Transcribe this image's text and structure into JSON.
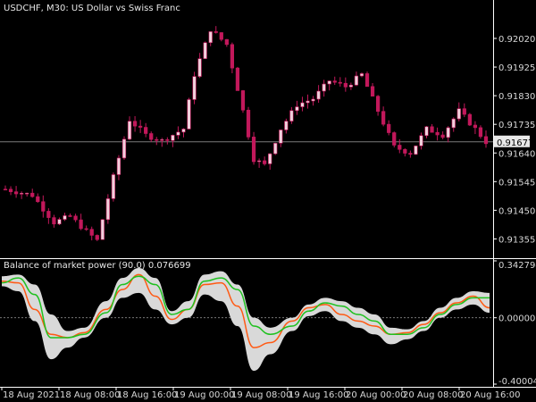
{
  "header": {
    "title": "USDCHF, M30:  US Dollar vs Swiss Franc"
  },
  "indicator": {
    "title": "Balance of market power (90.0) 0.076699"
  },
  "colors": {
    "background": "#000000",
    "candle": "#c2185b",
    "candle_light": "#f0d0dc",
    "axis": "#ffffff",
    "current_price_line": "#7a7a7a",
    "band_fill": "#d9d9d9",
    "green_line": "#1fc11f",
    "orange_line": "#ff5a14",
    "zero_line": "#777777"
  },
  "price_axis": {
    "labels": [
      "0.92020",
      "0.91925",
      "0.91830",
      "0.91735",
      "0.91640",
      "0.91545",
      "0.91450",
      "0.91355"
    ],
    "current_price": "0.91677"
  },
  "indicator_axis": {
    "labels": [
      "0.342794",
      "0.000000",
      "-0.400045"
    ]
  },
  "time_axis": {
    "labels": [
      "18 Aug 2021",
      "18 Aug 08:00",
      "18 Aug 16:00",
      "19 Aug 00:00",
      "19 Aug 08:00",
      "19 Aug 16:00",
      "20 Aug 00:00",
      "20 Aug 08:00",
      "20 Aug 16:00"
    ]
  },
  "chart_data": [
    {
      "type": "candlestick",
      "title": "USDCHF, M30:  US Dollar vs Swiss Franc",
      "ylim": [
        0.913,
        0.921
      ],
      "current_price": 0.91677,
      "bar_count": 90,
      "close_path": [
        {
          "bar": 0,
          "price": 0.9152
        },
        {
          "bar": 5,
          "price": 0.915
        },
        {
          "bar": 9,
          "price": 0.9141
        },
        {
          "bar": 12,
          "price": 0.9143
        },
        {
          "bar": 15,
          "price": 0.9138
        },
        {
          "bar": 17,
          "price": 0.9135
        },
        {
          "bar": 20,
          "price": 0.9156
        },
        {
          "bar": 23,
          "price": 0.9175
        },
        {
          "bar": 26,
          "price": 0.917
        },
        {
          "bar": 29,
          "price": 0.9168
        },
        {
          "bar": 33,
          "price": 0.9172
        },
        {
          "bar": 35,
          "price": 0.919
        },
        {
          "bar": 38,
          "price": 0.9205
        },
        {
          "bar": 41,
          "price": 0.92
        },
        {
          "bar": 44,
          "price": 0.9178
        },
        {
          "bar": 46,
          "price": 0.9162
        },
        {
          "bar": 48,
          "price": 0.916
        },
        {
          "bar": 51,
          "price": 0.9172
        },
        {
          "bar": 54,
          "price": 0.918
        },
        {
          "bar": 57,
          "price": 0.9182
        },
        {
          "bar": 60,
          "price": 0.9188
        },
        {
          "bar": 63,
          "price": 0.9186
        },
        {
          "bar": 66,
          "price": 0.919
        },
        {
          "bar": 69,
          "price": 0.9178
        },
        {
          "bar": 72,
          "price": 0.9166
        },
        {
          "bar": 75,
          "price": 0.9164
        },
        {
          "bar": 78,
          "price": 0.9172
        },
        {
          "bar": 81,
          "price": 0.917
        },
        {
          "bar": 84,
          "price": 0.9178
        },
        {
          "bar": 87,
          "price": 0.9172
        },
        {
          "bar": 89,
          "price": 0.91677
        }
      ]
    },
    {
      "type": "line",
      "title": "Balance of market power (90.0) 0.076699",
      "ylim": [
        -0.400045,
        0.342794
      ],
      "x_range": [
        0,
        89
      ],
      "series": [
        {
          "color": "#1fc11f",
          "values": [
            {
              "x": 0,
              "y": 0.21
            },
            {
              "x": 3,
              "y": 0.24
            },
            {
              "x": 6,
              "y": 0.14
            },
            {
              "x": 9,
              "y": -0.12
            },
            {
              "x": 12,
              "y": -0.12
            },
            {
              "x": 15,
              "y": -0.1
            },
            {
              "x": 19,
              "y": 0.03
            },
            {
              "x": 22,
              "y": 0.2
            },
            {
              "x": 25,
              "y": 0.25
            },
            {
              "x": 28,
              "y": 0.2
            },
            {
              "x": 31,
              "y": 0.02
            },
            {
              "x": 34,
              "y": 0.05
            },
            {
              "x": 37,
              "y": 0.22
            },
            {
              "x": 40,
              "y": 0.24
            },
            {
              "x": 43,
              "y": 0.17
            },
            {
              "x": 46,
              "y": -0.05
            },
            {
              "x": 49,
              "y": -0.1
            },
            {
              "x": 53,
              "y": -0.05
            },
            {
              "x": 56,
              "y": 0.04
            },
            {
              "x": 59,
              "y": 0.09
            },
            {
              "x": 62,
              "y": 0.07
            },
            {
              "x": 65,
              "y": 0.02
            },
            {
              "x": 68,
              "y": -0.02
            },
            {
              "x": 71,
              "y": -0.1
            },
            {
              "x": 74,
              "y": -0.1
            },
            {
              "x": 77,
              "y": -0.06
            },
            {
              "x": 80,
              "y": 0.02
            },
            {
              "x": 83,
              "y": 0.08
            },
            {
              "x": 86,
              "y": 0.12
            },
            {
              "x": 89,
              "y": 0.12
            }
          ]
        },
        {
          "color": "#ff5a14",
          "values": [
            {
              "x": 0,
              "y": 0.22
            },
            {
              "x": 3,
              "y": 0.21
            },
            {
              "x": 6,
              "y": 0.05
            },
            {
              "x": 9,
              "y": -0.1
            },
            {
              "x": 12,
              "y": -0.12
            },
            {
              "x": 15,
              "y": -0.09
            },
            {
              "x": 19,
              "y": 0.05
            },
            {
              "x": 22,
              "y": 0.17
            },
            {
              "x": 25,
              "y": 0.26
            },
            {
              "x": 28,
              "y": 0.13
            },
            {
              "x": 31,
              "y": -0.01
            },
            {
              "x": 34,
              "y": 0.05
            },
            {
              "x": 37,
              "y": 0.2
            },
            {
              "x": 40,
              "y": 0.21
            },
            {
              "x": 43,
              "y": 0.07
            },
            {
              "x": 46,
              "y": -0.18
            },
            {
              "x": 49,
              "y": -0.15
            },
            {
              "x": 53,
              "y": -0.02
            },
            {
              "x": 56,
              "y": 0.06
            },
            {
              "x": 59,
              "y": 0.08
            },
            {
              "x": 62,
              "y": 0.02
            },
            {
              "x": 65,
              "y": -0.02
            },
            {
              "x": 68,
              "y": -0.05
            },
            {
              "x": 71,
              "y": -0.1
            },
            {
              "x": 74,
              "y": -0.09
            },
            {
              "x": 77,
              "y": -0.04
            },
            {
              "x": 80,
              "y": 0.03
            },
            {
              "x": 83,
              "y": 0.09
            },
            {
              "x": 86,
              "y": 0.13
            },
            {
              "x": 89,
              "y": 0.06
            }
          ]
        },
        {
          "color": "#d9d9d9",
          "type": "area",
          "upper": [
            {
              "x": 0,
              "y": 0.25
            },
            {
              "x": 3,
              "y": 0.26
            },
            {
              "x": 6,
              "y": 0.2
            },
            {
              "x": 9,
              "y": 0.02
            },
            {
              "x": 12,
              "y": -0.08
            },
            {
              "x": 15,
              "y": -0.06
            },
            {
              "x": 19,
              "y": 0.1
            },
            {
              "x": 22,
              "y": 0.24
            },
            {
              "x": 25,
              "y": 0.3
            },
            {
              "x": 28,
              "y": 0.24
            },
            {
              "x": 31,
              "y": 0.04
            },
            {
              "x": 34,
              "y": 0.1
            },
            {
              "x": 37,
              "y": 0.26
            },
            {
              "x": 40,
              "y": 0.28
            },
            {
              "x": 43,
              "y": 0.2
            },
            {
              "x": 46,
              "y": 0.0
            },
            {
              "x": 49,
              "y": -0.06
            },
            {
              "x": 53,
              "y": 0.0
            },
            {
              "x": 56,
              "y": 0.08
            },
            {
              "x": 59,
              "y": 0.12
            },
            {
              "x": 62,
              "y": 0.1
            },
            {
              "x": 65,
              "y": 0.06
            },
            {
              "x": 68,
              "y": 0.02
            },
            {
              "x": 71,
              "y": -0.06
            },
            {
              "x": 74,
              "y": -0.07
            },
            {
              "x": 77,
              "y": -0.02
            },
            {
              "x": 80,
              "y": 0.06
            },
            {
              "x": 83,
              "y": 0.12
            },
            {
              "x": 86,
              "y": 0.16
            },
            {
              "x": 89,
              "y": 0.15
            }
          ],
          "lower": [
            {
              "x": 0,
              "y": 0.19
            },
            {
              "x": 3,
              "y": 0.16
            },
            {
              "x": 6,
              "y": -0.02
            },
            {
              "x": 9,
              "y": -0.25
            },
            {
              "x": 12,
              "y": -0.18
            },
            {
              "x": 15,
              "y": -0.12
            },
            {
              "x": 19,
              "y": 0.0
            },
            {
              "x": 22,
              "y": 0.12
            },
            {
              "x": 25,
              "y": 0.15
            },
            {
              "x": 28,
              "y": 0.05
            },
            {
              "x": 31,
              "y": -0.04
            },
            {
              "x": 34,
              "y": 0.0
            },
            {
              "x": 37,
              "y": 0.14
            },
            {
              "x": 40,
              "y": 0.1
            },
            {
              "x": 43,
              "y": -0.05
            },
            {
              "x": 46,
              "y": -0.32
            },
            {
              "x": 49,
              "y": -0.22
            },
            {
              "x": 53,
              "y": -0.08
            },
            {
              "x": 56,
              "y": 0.01
            },
            {
              "x": 59,
              "y": 0.04
            },
            {
              "x": 62,
              "y": -0.02
            },
            {
              "x": 65,
              "y": -0.06
            },
            {
              "x": 68,
              "y": -0.1
            },
            {
              "x": 71,
              "y": -0.16
            },
            {
              "x": 74,
              "y": -0.13
            },
            {
              "x": 77,
              "y": -0.08
            },
            {
              "x": 80,
              "y": 0.0
            },
            {
              "x": 83,
              "y": 0.05
            },
            {
              "x": 86,
              "y": 0.08
            },
            {
              "x": 89,
              "y": 0.03
            }
          ]
        }
      ]
    }
  ]
}
